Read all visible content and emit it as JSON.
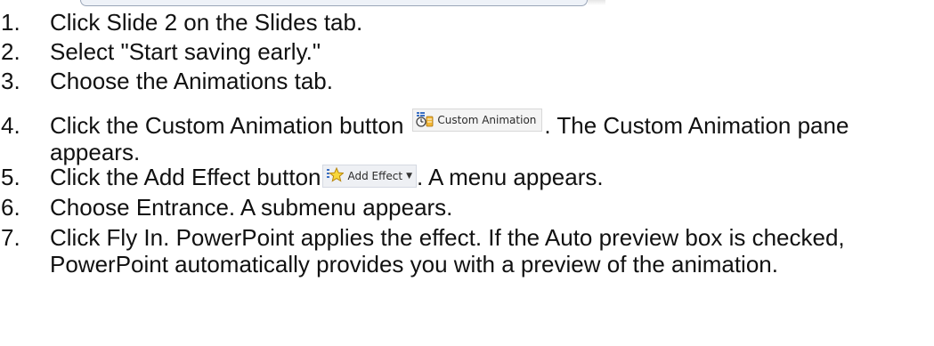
{
  "steps": [
    {
      "num": "1.",
      "text": "Click Slide 2 on the Slides tab."
    },
    {
      "num": "2.",
      "text": "Select \"Start saving early.\""
    },
    {
      "num": "3.",
      "text": "Choose the Animations tab."
    },
    {
      "num": "4.",
      "before": "Click the Custom Animation button",
      "button_label": "Custom Animation",
      "after": ". The Custom Animation pane appears."
    },
    {
      "num": "5.",
      "before": "Click the Add Effect button",
      "button_label": "Add Effect",
      "after": ". A menu appears."
    },
    {
      "num": "6.",
      "text": "Choose Entrance. A submenu appears."
    },
    {
      "num": "7.",
      "text": "Click Fly In. PowerPoint applies the effect. If the Auto preview box is checked, PowerPoint automatically provides you with a preview of the animation."
    }
  ],
  "icons": {
    "custom_animation": "custom-animation-icon",
    "add_effect": "add-effect-star-icon",
    "dropdown": "dropdown-arrow-icon"
  }
}
